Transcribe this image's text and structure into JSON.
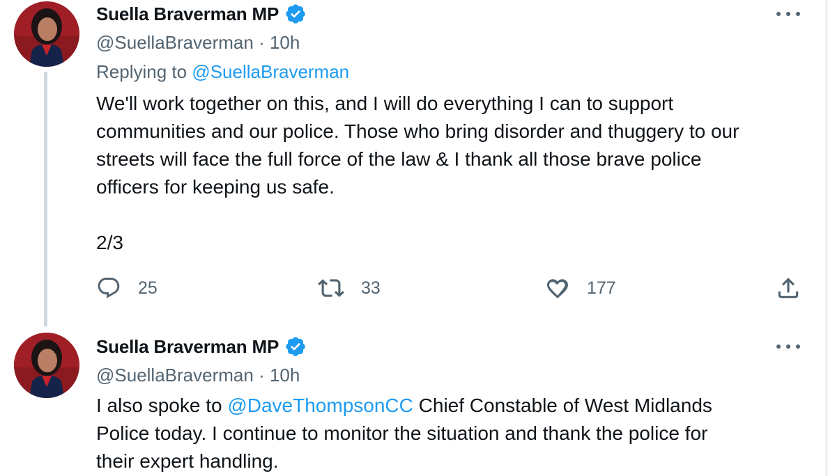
{
  "tweets": [
    {
      "author": "Suella Braverman MP",
      "handle": "@SuellaBraverman",
      "separator": "·",
      "time": "10h",
      "replying_label": "Replying to",
      "replying_to": "@SuellaBraverman",
      "text": "We'll work together on this, and I will do everything I can to support\ncommunities and our police. Those who bring disorder and thuggery to our\nstreets will face the full force of the law & I thank all those brave police\nofficers for keeping us safe.\n\n2/3",
      "replies": "25",
      "retweets": "33",
      "likes": "177"
    },
    {
      "author": "Suella Braverman MP",
      "handle": "@SuellaBraverman",
      "separator": "·",
      "time": "10h",
      "text_before": "I also spoke to ",
      "mention": "@DaveThompsonCC",
      "text_after": " Chief Constable of West Midlands\nPolice today. I continue to monitor the situation and thank the police for\ntheir expert handling."
    }
  ],
  "icons": {
    "verified": "verified-badge-icon",
    "more": "more-options-icon",
    "reply": "reply-bubble-icon",
    "retweet": "retweet-icon",
    "like": "heart-icon",
    "share": "share-icon"
  },
  "colors": {
    "accent": "#1d9bf0",
    "muted_text": "#536471",
    "primary_text": "#0f1419",
    "thread_line": "#cfd9de"
  }
}
